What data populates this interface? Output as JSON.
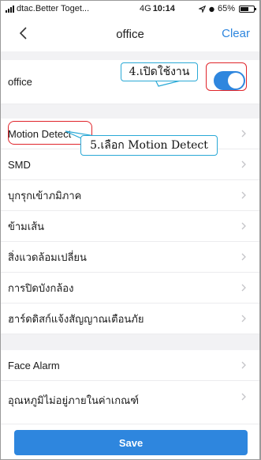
{
  "status_bar": {
    "carrier": "dtac.Better Toget...",
    "network": "4G",
    "time": "10:14",
    "battery_percent": "65%",
    "battery_level": 0.65
  },
  "nav": {
    "title": "office",
    "clear_label": "Clear",
    "back_icon": "chevron-left-icon"
  },
  "master_toggle": {
    "label": "office",
    "on": true,
    "accent": "#2e86de"
  },
  "settings_group_1": [
    {
      "label": "Motion Detect"
    },
    {
      "label": "SMD"
    },
    {
      "label": "บุกรุกเข้าภมิภาค"
    },
    {
      "label": "ข้ามเส้น"
    },
    {
      "label": "สิ่งแวดล้อมเปลี่ยน"
    },
    {
      "label": "การปิดบังกล้อง"
    },
    {
      "label": "ฮาร์ดดิสก์แจ้งสัญญาณเตือนภัย"
    }
  ],
  "settings_group_2": [
    {
      "label": "Face Alarm"
    },
    {
      "label": "อุณหภูมิไม่อยู่ภายในค่าเกณฑ์"
    }
  ],
  "annotations": {
    "step4": "4.เปิดใช้งาน",
    "step5": "5.เลือก Motion Detect",
    "highlight_color": "#e0252b",
    "callout_color": "#2aa9d6"
  },
  "save_label": "Save"
}
